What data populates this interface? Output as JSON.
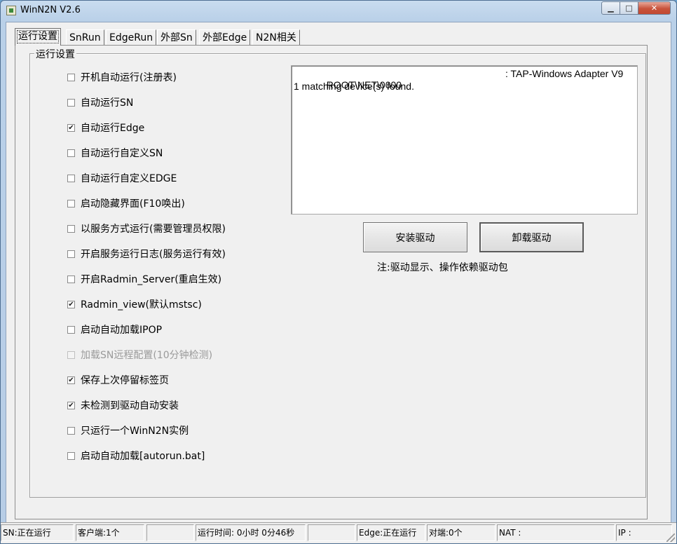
{
  "window": {
    "title": "WinN2N V2.6"
  },
  "title_buttons": {
    "minimize": "▁",
    "maximize": "□",
    "close": "✕"
  },
  "tabs": [
    {
      "label": "运行设置",
      "active": true
    },
    {
      "label": "SnRun"
    },
    {
      "label": "EdgeRun"
    },
    {
      "label": "外部Sn"
    },
    {
      "label": "外部Edge"
    },
    {
      "label": "N2N相关"
    }
  ],
  "group": {
    "label": "运行设置"
  },
  "checkboxes": [
    {
      "label": "开机自动运行(注册表)",
      "checked": false,
      "disabled": false
    },
    {
      "label": "自动运行SN",
      "checked": false,
      "disabled": false
    },
    {
      "label": "自动运行Edge",
      "checked": true,
      "disabled": false
    },
    {
      "label": "自动运行自定义SN",
      "checked": false,
      "disabled": false
    },
    {
      "label": "自动运行自定义EDGE",
      "checked": false,
      "disabled": false
    },
    {
      "label": "启动隐藏界面(F10唤出)",
      "checked": false,
      "disabled": false
    },
    {
      "label": "以服务方式运行(需要管理员权限)",
      "checked": false,
      "disabled": false
    },
    {
      "label": "开启服务运行日志(服务运行有效)",
      "checked": false,
      "disabled": false
    },
    {
      "label": "开启Radmin_Server(重启生效)",
      "checked": false,
      "disabled": false
    },
    {
      "label": "Radmin_view(默认mstsc)",
      "checked": true,
      "disabled": false
    },
    {
      "label": "启动自动加载IPOP",
      "checked": false,
      "disabled": false
    },
    {
      "label": "加载SN远程配置(10分钟检测)",
      "checked": false,
      "disabled": true
    },
    {
      "label": "保存上次停留标签页",
      "checked": true,
      "disabled": false
    },
    {
      "label": "未检测到驱动自动安装",
      "checked": true,
      "disabled": false
    },
    {
      "label": "只运行一个WinN2N实例",
      "checked": false,
      "disabled": false
    },
    {
      "label": "启动自动加载[autorun.bat]",
      "checked": false,
      "disabled": false
    }
  ],
  "output": {
    "line1_left": "ROOT\\NET\\0000",
    "line1_right": ": TAP-Windows Adapter V9",
    "line2": "1 matching device(s) found."
  },
  "buttons": {
    "install": "安装驱动",
    "uninstall": "卸载驱动"
  },
  "note": "注:驱动显示、操作依赖驱动包",
  "status": {
    "sn": "SN:正在运行",
    "clients": "客户端:1个",
    "blank": "",
    "runtime": "运行时间: 0小时 0分46秒",
    "blank2": "",
    "edge": "Edge:正在运行",
    "peers": "对端:0个",
    "nat": "NAT :",
    "ip": "IP :"
  },
  "checkmark": "✔"
}
